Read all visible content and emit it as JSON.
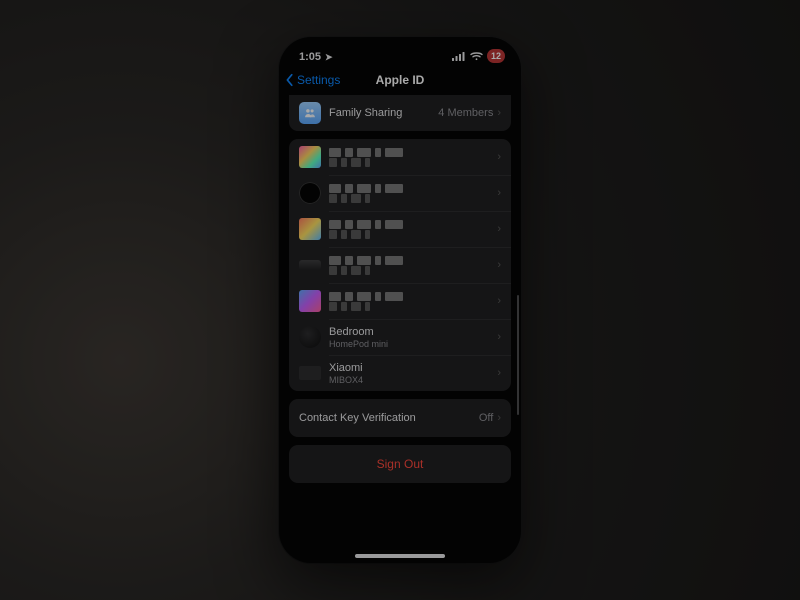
{
  "status_bar": {
    "time": "1:05",
    "location_active": true,
    "battery_percent": "12"
  },
  "nav": {
    "back_label": "Settings",
    "title": "Apple ID"
  },
  "family_sharing": {
    "label": "Family Sharing",
    "value": "4 Members"
  },
  "devices": [
    {
      "id": "iphone",
      "title_redacted": true,
      "subtitle_redacted": true,
      "icon": "iphone-color"
    },
    {
      "id": "watch",
      "title_redacted": true,
      "subtitle_redacted": true,
      "icon": "apple-watch"
    },
    {
      "id": "ipad",
      "title_redacted": true,
      "subtitle_redacted": true,
      "icon": "ipad-color"
    },
    {
      "id": "macmini",
      "title_redacted": true,
      "subtitle_redacted": true,
      "icon": "macmini"
    },
    {
      "id": "monitor",
      "title_redacted": true,
      "subtitle_redacted": true,
      "icon": "monitor"
    },
    {
      "id": "homepod",
      "title": "Bedroom",
      "subtitle": "HomePod mini",
      "icon": "homepod"
    },
    {
      "id": "mibox",
      "title": "Xiaomi",
      "subtitle": "MIBOX4",
      "icon": "mibox"
    }
  ],
  "contact_key": {
    "label": "Contact Key Verification",
    "value": "Off"
  },
  "sign_out": {
    "label": "Sign Out"
  }
}
